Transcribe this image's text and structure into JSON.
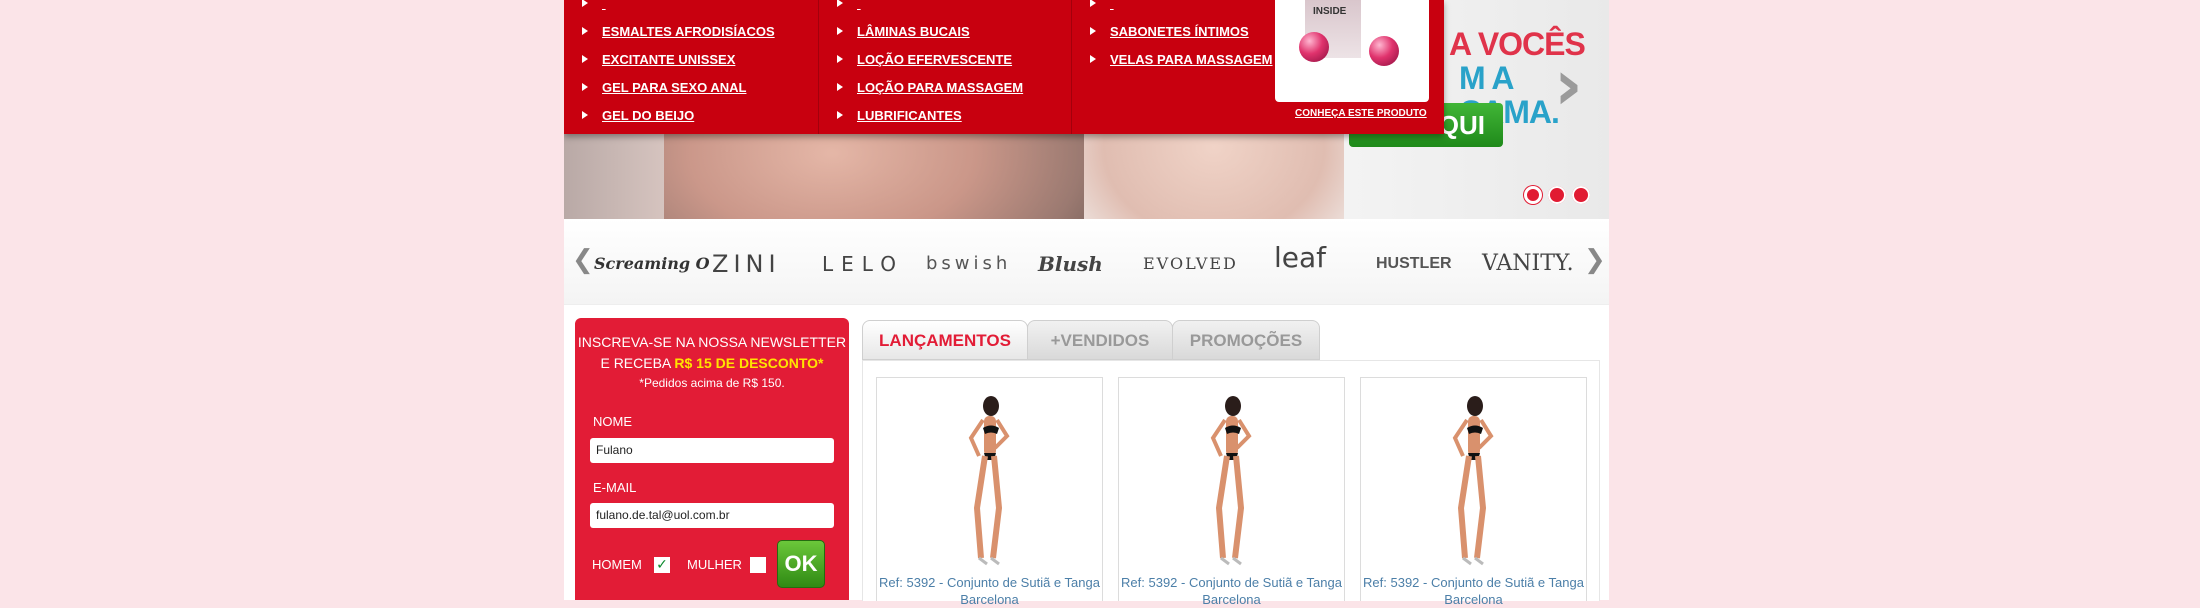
{
  "menu": {
    "col1": [
      "ESMALTES AFRODISÍACOS",
      "EXCITANTE UNISSEX",
      "GEL PARA SEXO ANAL",
      "GEL DO BEIJO"
    ],
    "col2": [
      "LÂMINAS BUCAIS",
      "LOÇÃO EFERVESCENTE",
      "LOÇÃO PARA MASSAGEM",
      "LUBRIFICANTES"
    ],
    "col3": [
      "SABONETES ÍNTIMOS",
      "VELAS PARA MASSAGEM"
    ],
    "product_box_label": "INSIDE",
    "product_link": "CONHEÇA ESTE PRODUTO"
  },
  "banner": {
    "headline_line1": "A VOCÊS",
    "headline_line2": "M A CAMA.",
    "cta": "AQUI",
    "slides": 3,
    "active_slide": 1
  },
  "brands": {
    "items": [
      "Screaming O",
      "ZINI",
      "LELO",
      "bswish",
      "Blush",
      "EVOLVED",
      "leaf",
      "HUSTLER",
      "VANITY."
    ],
    "prev_arrow": "❮",
    "next_arrow": "❯"
  },
  "newsletter": {
    "title_line1": "INSCREVA-SE NA NOSSA NEWSLETTER",
    "title_line2_prefix": "E RECEBA",
    "title_line2_highlight": "R$ 15 DE DESCONTO*",
    "note": "*Pedidos acima de R$ 150.",
    "name_label": "NOME",
    "name_value": "Fulano",
    "email_label": "E-MAIL",
    "email_value": "fulano.de.tal@uol.com.br",
    "gender_male": "HOMEM",
    "gender_female": "MULHER",
    "male_checked": true,
    "female_checked": false,
    "submit": "OK"
  },
  "tabs": [
    "LANÇAMENTOS",
    "+VENDIDOS",
    "PROMOÇÕES"
  ],
  "active_tab": 0,
  "products": [
    {
      "caption": "Ref: 5392 - Conjunto de Sutiã e Tanga Barcelona"
    },
    {
      "caption": "Ref: 5392 - Conjunto de Sutiã e Tanga Barcelona"
    },
    {
      "caption": "Ref: 5392 - Conjunto de Sutiã e Tanga Barcelona"
    }
  ],
  "colors": {
    "page_bg": "#fbe4e8",
    "menu_red": "#c8000f",
    "newsletter_red": "#e21c36",
    "highlight_yellow": "#ffe400",
    "ok_green": "#2f8a14"
  }
}
